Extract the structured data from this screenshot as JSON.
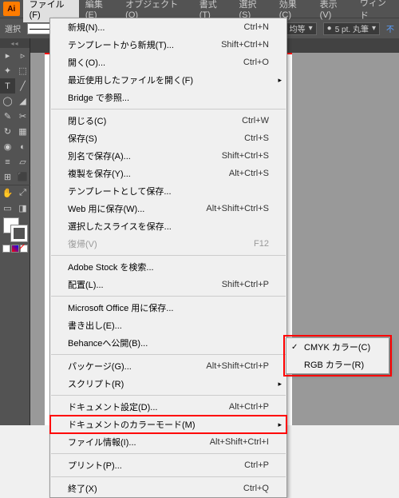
{
  "app_icon": "Ai",
  "menubar": [
    "ファイル(F)",
    "編集(E)",
    "オブジェクト(O)",
    "書式(T)",
    "選択(S)",
    "効果(C)",
    "表示(V)",
    "ウィンド"
  ],
  "toolbar": {
    "select_label": "選択",
    "uniform": "均等",
    "stroke_preset": "5 pt. 丸筆",
    "unknown": "不"
  },
  "file_menu": [
    {
      "label": "新規(N)...",
      "shortcut": "Ctrl+N"
    },
    {
      "label": "テンプレートから新規(T)...",
      "shortcut": "Shift+Ctrl+N"
    },
    {
      "label": "開く(O)...",
      "shortcut": "Ctrl+O"
    },
    {
      "label": "最近使用したファイルを開く(F)",
      "submenu": true
    },
    {
      "label": "Bridge で参照...",
      "shortcut": ""
    },
    {
      "sep": true
    },
    {
      "label": "閉じる(C)",
      "shortcut": "Ctrl+W"
    },
    {
      "label": "保存(S)",
      "shortcut": "Ctrl+S"
    },
    {
      "label": "別名で保存(A)...",
      "shortcut": "Shift+Ctrl+S"
    },
    {
      "label": "複製を保存(Y)...",
      "shortcut": "Alt+Ctrl+S"
    },
    {
      "label": "テンプレートとして保存...",
      "shortcut": ""
    },
    {
      "label": "Web 用に保存(W)...",
      "shortcut": "Alt+Shift+Ctrl+S"
    },
    {
      "label": "選択したスライスを保存...",
      "shortcut": ""
    },
    {
      "label": "復帰(V)",
      "shortcut": "F12",
      "disabled": true
    },
    {
      "sep": true
    },
    {
      "label": "Adobe Stock を検索...",
      "shortcut": ""
    },
    {
      "label": "配置(L)...",
      "shortcut": "Shift+Ctrl+P"
    },
    {
      "sep": true
    },
    {
      "label": "Microsoft Office 用に保存...",
      "shortcut": ""
    },
    {
      "label": "書き出し(E)...",
      "shortcut": ""
    },
    {
      "label": "Behanceへ公開(B)...",
      "shortcut": ""
    },
    {
      "sep": true
    },
    {
      "label": "パッケージ(G)...",
      "shortcut": "Alt+Shift+Ctrl+P"
    },
    {
      "label": "スクリプト(R)",
      "submenu": true
    },
    {
      "sep": true
    },
    {
      "label": "ドキュメント設定(D)...",
      "shortcut": "Alt+Ctrl+P"
    },
    {
      "label": "ドキュメントのカラーモード(M)",
      "submenu": true,
      "highlighted": true
    },
    {
      "label": "ファイル情報(I)...",
      "shortcut": "Alt+Shift+Ctrl+I"
    },
    {
      "sep": true
    },
    {
      "label": "プリント(P)...",
      "shortcut": "Ctrl+P"
    },
    {
      "sep": true
    },
    {
      "label": "終了(X)",
      "shortcut": "Ctrl+Q"
    }
  ],
  "color_mode_submenu": [
    {
      "label": "CMYK カラー(C)",
      "checked": true
    },
    {
      "label": "RGB カラー(R)",
      "checked": false
    }
  ],
  "tool_icons": [
    "▸",
    "▹",
    "✦",
    "⬚",
    "T",
    "╱",
    "◯",
    "◢",
    "✎",
    "✂",
    "↻",
    "▦",
    "◉",
    "◐",
    "≡",
    "▱",
    "⊞",
    "⬛",
    "✋",
    "⤢",
    "▭",
    "◨"
  ]
}
